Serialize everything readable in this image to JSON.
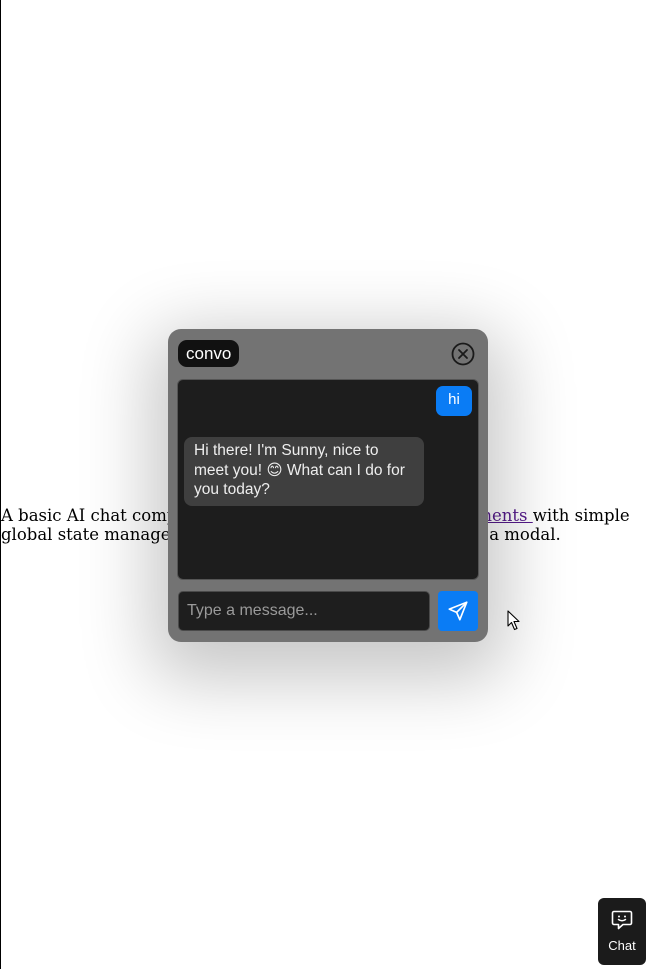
{
  "page": {
    "text_before": "A basic AI chat compo",
    "link_text": "nents ",
    "text_after": "with simple",
    "text_line2_start": "global state managem",
    "text_line2_end": "a modal."
  },
  "chat_modal": {
    "brand": "convo",
    "close_icon": "close-circle-icon",
    "messages": [
      {
        "role": "user",
        "text": "hi"
      },
      {
        "role": "assistant",
        "text": "Hi there! I'm Sunny, nice to meet you! 😊 What can I do for you today?"
      }
    ],
    "input": {
      "placeholder": "Type a message...",
      "value": ""
    },
    "send_icon": "send-icon"
  },
  "launcher": {
    "label": "Chat",
    "icon": "chat-bubble-icon"
  },
  "colors": {
    "accent": "#0a7cf5",
    "modal_bg": "#737373",
    "messages_bg": "#1d1d1d",
    "bot_bubble": "#3f3f3f",
    "link": "#551a8b"
  }
}
